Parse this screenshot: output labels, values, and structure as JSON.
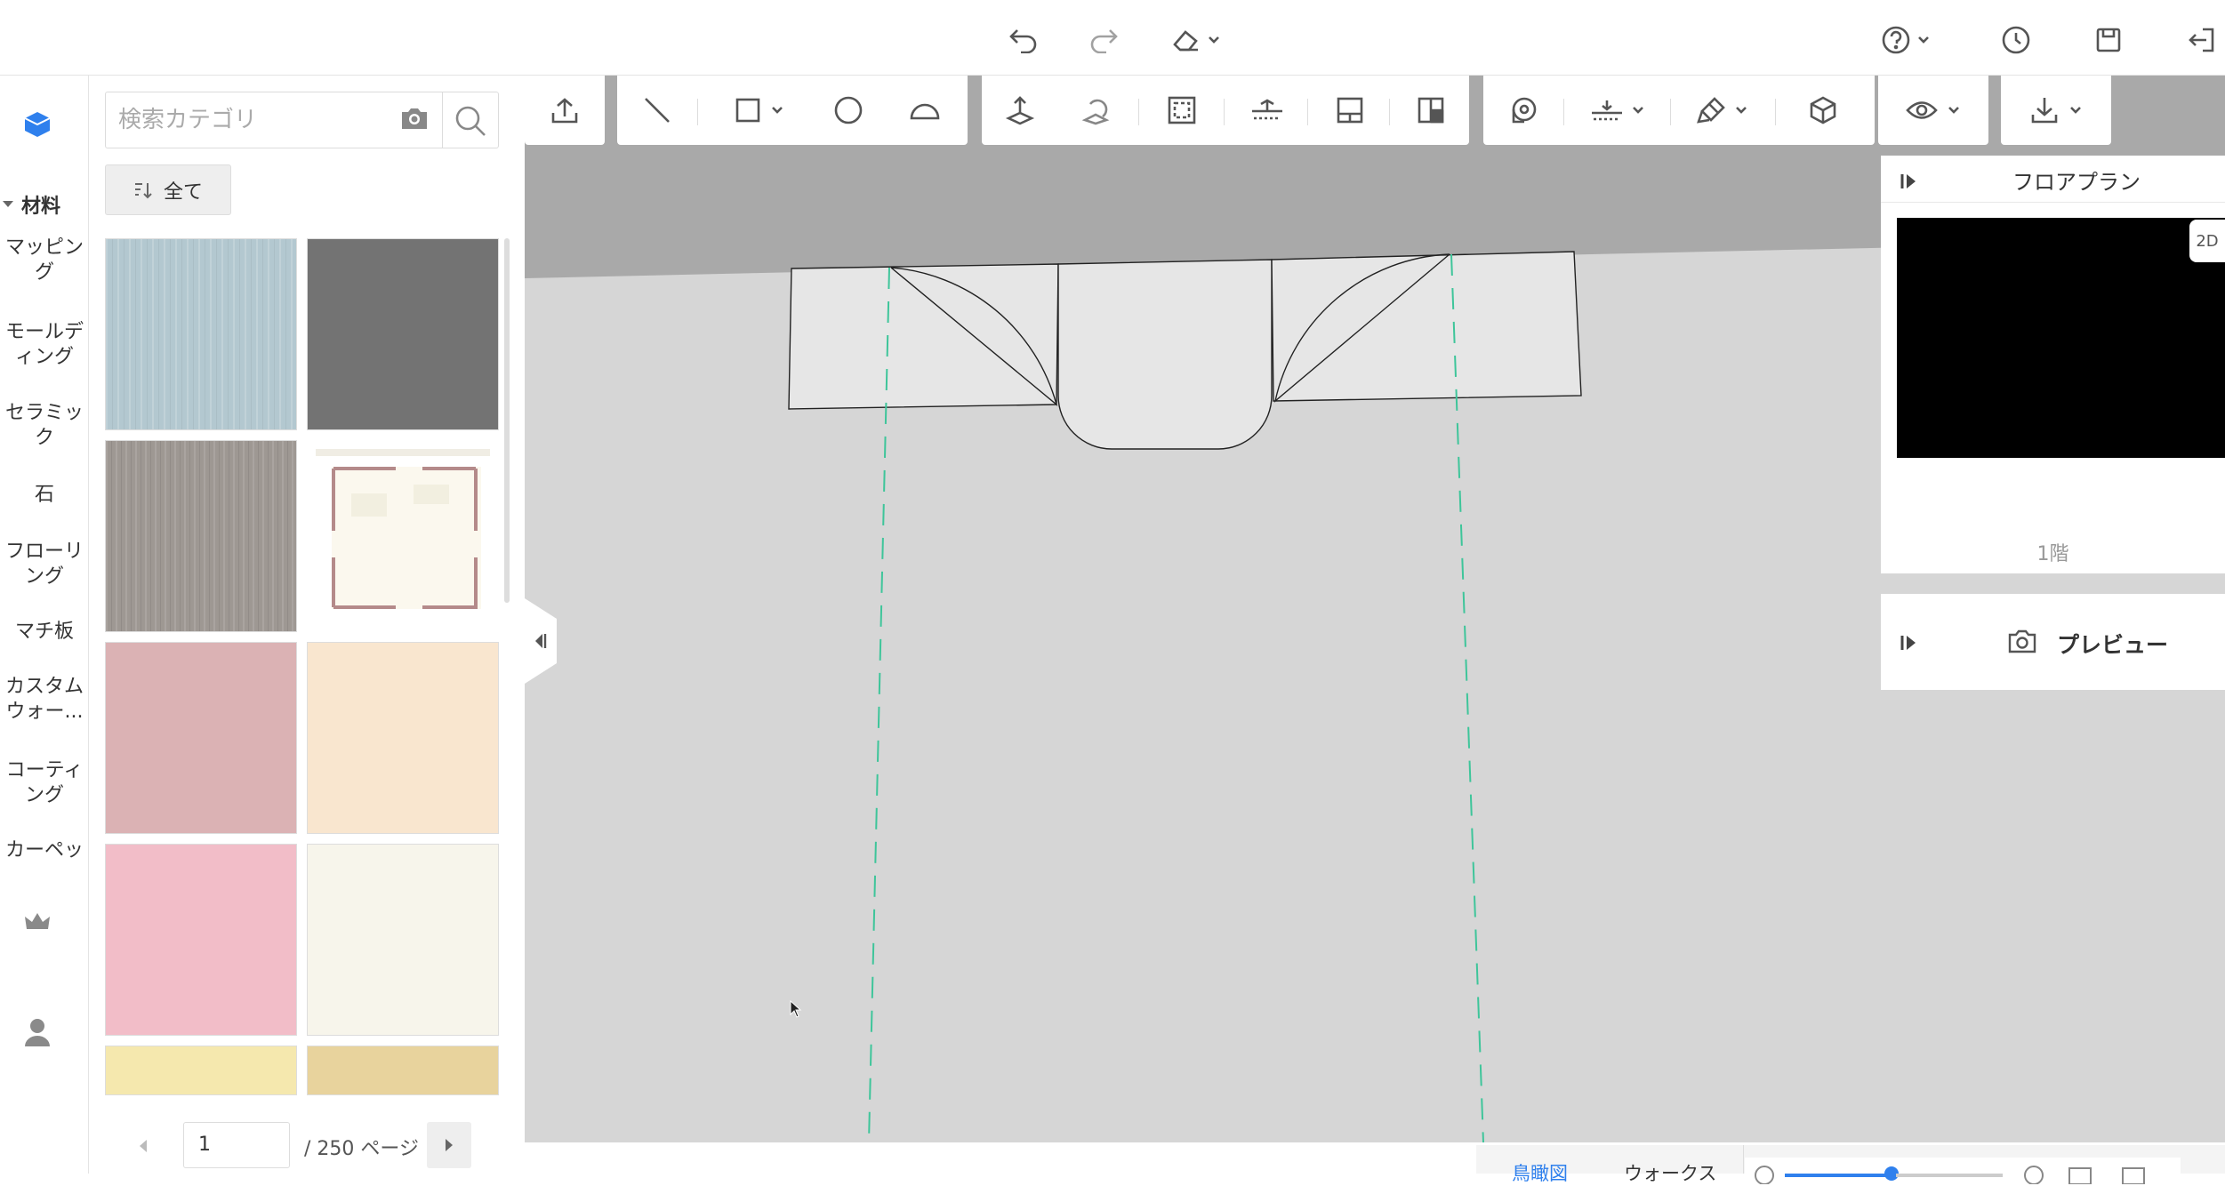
{
  "toolbar_top": {
    "icons": [
      "undo-icon",
      "redo-icon",
      "eraser-icon",
      "help-icon",
      "history-icon",
      "save-icon",
      "exit-icon"
    ]
  },
  "leftnav": {
    "brand_icon": "cube-icon",
    "section_title": "材料",
    "categories": [
      "マッピン\nグ",
      "モールデ\nィング",
      "セラミッ\nク",
      "石",
      "フローリ\nング",
      "マチ板",
      "カスタム\nウォー...",
      "コーティ\nング",
      "カーペッ"
    ],
    "bottom_icons": [
      "crown-icon",
      "user-icon"
    ]
  },
  "panel": {
    "search_placeholder": "検索カテゴリ",
    "filter_label": "全て",
    "swatches": [
      {
        "name": "light-blue-wood",
        "color": "#b3c8d0"
      },
      {
        "name": "dark-gray",
        "color": "#737373"
      },
      {
        "name": "gray-wood",
        "color": "#9e9893"
      },
      {
        "name": "floorplan-thumbnail",
        "color": "#ffffff"
      },
      {
        "name": "dusty-pink",
        "color": "#dbb2b4"
      },
      {
        "name": "peach",
        "color": "#f9e6cf"
      },
      {
        "name": "pink",
        "color": "#f2bdc8"
      },
      {
        "name": "ivory",
        "color": "#f7f5eb"
      },
      {
        "name": "light-yellow",
        "color": "#f5e8ae"
      },
      {
        "name": "sand",
        "color": "#e8d39d"
      }
    ],
    "pager": {
      "current": "1",
      "total_label": "/ 250 ページ"
    }
  },
  "floorplan_panel": {
    "title": "フロアプラン",
    "mode_tab": "2D",
    "floor_label": "1階"
  },
  "preview_panel": {
    "title": "プレビュー"
  },
  "bottom_bar": {
    "tab1": "鳥瞰図",
    "tab2": "ウォークス"
  },
  "colors": {
    "accent": "#2f80ed",
    "guide_line": "#3ec59a",
    "canvas_floor": "#d6d6d6",
    "canvas_wall": "#a9a9a9"
  }
}
